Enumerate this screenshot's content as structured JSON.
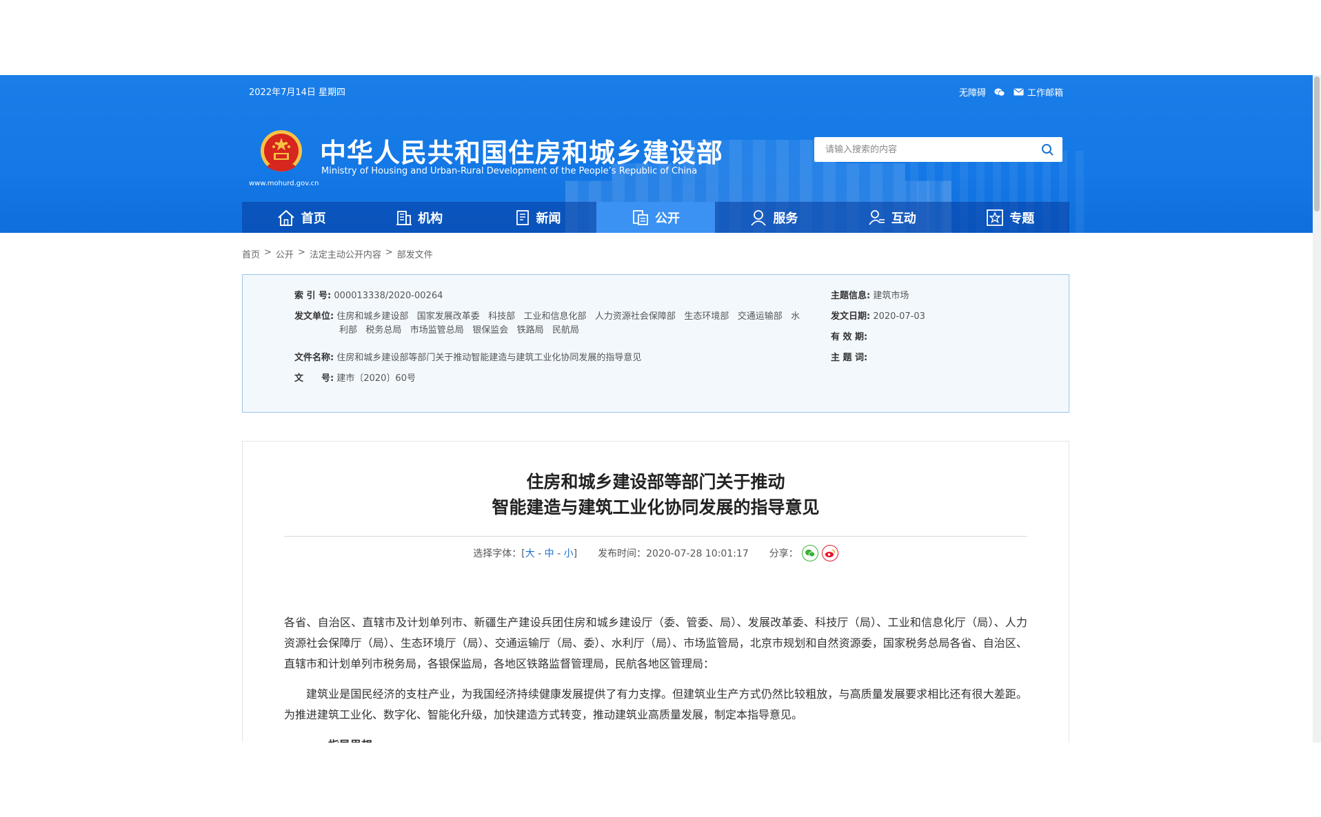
{
  "header": {
    "date": "2022年7月14日 星期四",
    "links": {
      "accessibility": "无障碍",
      "mail": "工作邮箱"
    },
    "site_url": "www.mohurd.gov.cn",
    "title": "中华人民共和国住房和城乡建设部",
    "subtitle": "Ministry of Housing and Urban-Rural Development of the People’s Republic of China",
    "search_placeholder": "请输入搜索的内容",
    "nav": [
      {
        "label": "首页",
        "icon": "home-icon"
      },
      {
        "label": "机构",
        "icon": "building-icon"
      },
      {
        "label": "新闻",
        "icon": "news-icon"
      },
      {
        "label": "公开",
        "icon": "document-icon",
        "active": true
      },
      {
        "label": "服务",
        "icon": "service-icon"
      },
      {
        "label": "互动",
        "icon": "interaction-icon"
      },
      {
        "label": "专题",
        "icon": "star-icon"
      }
    ]
  },
  "breadcrumb": [
    "首页",
    "公开",
    "法定主动公开内容",
    "部发文件"
  ],
  "meta": {
    "index_label": "索 引 号:",
    "index_value": "000013338/2020-00264",
    "issuer_label": "发文单位:",
    "issuer_line1": "住房和城乡建设部   国家发展改革委   科技部   工业和信息化部   人力资源社会保障部   生态环境部   交通运输部   水",
    "issuer_line2": "利部   税务总局   市场监管总局   银保监会   铁路局   民航局",
    "docname_label": "文件名称:",
    "docname_value": "住房和城乡建设部等部门关于推动智能建造与建筑工业化协同发展的指导意见",
    "docno_label": "文　　号:",
    "docno_value": "建市〔2020〕60号",
    "topic_label": "主题信息:",
    "topic_value": "建筑市场",
    "date_label": "发文日期:",
    "date_value": "2020-07-03",
    "valid_label": "有 效 期:",
    "keywords_label": "主 题 词:"
  },
  "article": {
    "title_line1": "住房和城乡建设部等部门关于推动",
    "title_line2": "智能建造与建筑工业化协同发展的指导意见",
    "font_label": "选择字体：[",
    "font_large": "大",
    "font_medium": "中",
    "font_small": "小",
    "font_close": "]",
    "publish_label": "发布时间：",
    "publish_time": "2020-07-28 10:01:17",
    "share_label": "分享：",
    "para1": "各省、自治区、直辖市及计划单列市、新疆生产建设兵团住房和城乡建设厅（委、管委、局）、发展改革委、科技厅（局）、工业和信息化厅（局）、人力资源社会保障厅（局）、生态环境厅（局）、交通运输厅（局、委）、水利厅（局）、市场监管局，北京市规划和自然资源委，国家税务总局各省、自治区、直辖市和计划单列市税务局，各银保监局，各地区铁路监督管理局，民航各地区管理局：",
    "para2": "建筑业是国民经济的支柱产业，为我国经济持续健康发展提供了有力支撑。但建筑业生产方式仍然比较粗放，与高质量发展要求相比还有很大差距。为推进建筑工业化、数字化、智能化升级，加快建造方式转变，推动建筑业高质量发展，制定本指导意见。",
    "para3": "一、指导思想"
  },
  "colors": {
    "header_blue": "#1478e6",
    "nav_active": "#3b92f2",
    "link_blue": "#1a6fd1",
    "wechat_green": "#3cb034",
    "weibo_red": "#e6162d"
  }
}
